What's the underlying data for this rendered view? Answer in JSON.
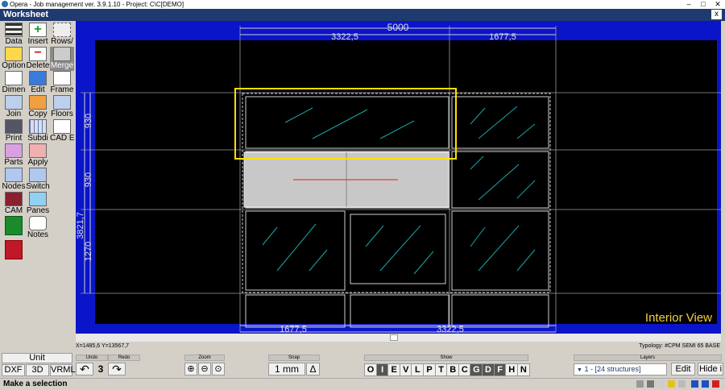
{
  "window": {
    "title": "Opera - Job management ver. 3.9.1.10 - Project: C\\C[DEMO]",
    "min_label": "–",
    "max_label": "□",
    "close_label": "✕"
  },
  "worksheet": {
    "title": "Worksheet",
    "close_label": "x"
  },
  "toolbar": [
    {
      "label": "Data"
    },
    {
      "label": "Insert"
    },
    {
      "label": "Rows/"
    },
    {
      "label": "Option"
    },
    {
      "label": "Delete"
    },
    {
      "label": "Merge"
    },
    {
      "label": "Dimen"
    },
    {
      "label": "Edit"
    },
    {
      "label": "Frame"
    },
    {
      "label": "Join"
    },
    {
      "label": "Copy"
    },
    {
      "label": "Floors"
    },
    {
      "label": "Print"
    },
    {
      "label": "Subdi"
    },
    {
      "label": "CAD E"
    },
    {
      "label": "Parts"
    },
    {
      "label": "Apply"
    },
    {
      "label": "Nodes"
    },
    {
      "label": "Switch"
    },
    {
      "label": "CAM"
    },
    {
      "label": "Panes"
    },
    {
      "label": ""
    },
    {
      "label": "Notes"
    },
    {
      "label": ""
    }
  ],
  "drawing": {
    "dim_total": "5000",
    "dim_top_left": "3322,5",
    "dim_top_right": "1677,5",
    "dim_bottom_left": "1677,5",
    "dim_bottom_right": "3322,5",
    "dim_left_total": "3821,7",
    "dim_left_1": "930",
    "dim_left_2": "930",
    "dim_left_3": "1270",
    "view_label": "Interior View"
  },
  "coordinates": "X=1485,6  Y=13567,7",
  "typology": "Typology: #CPM SEMI 65 BASE",
  "bottom": {
    "unit_title": "Unit",
    "unit_buttons": [
      "DXF",
      "3D",
      "VRML"
    ],
    "undo_title": "Undo",
    "redo_title": "Redo",
    "undo_count": "3",
    "zoom_title": "Zoom",
    "snap_title": "Snap",
    "snap_value": "1 mm",
    "snap_delta": "Δ",
    "show_title": "Show",
    "show_buttons": [
      "O",
      "I",
      "E",
      "V",
      "L",
      "P",
      "T",
      "B",
      "C",
      "G",
      "D",
      "F",
      "H",
      "N"
    ],
    "layers_title": "Layers",
    "layers_value": "1 - [24 structures]",
    "edit_label": "Edit",
    "hide_label": "Hide i"
  },
  "status": "Make a selection",
  "colors": {
    "canvas_frame": "#0a14c8",
    "highlight": "#ffe000",
    "dims": "#c8c8c8"
  }
}
